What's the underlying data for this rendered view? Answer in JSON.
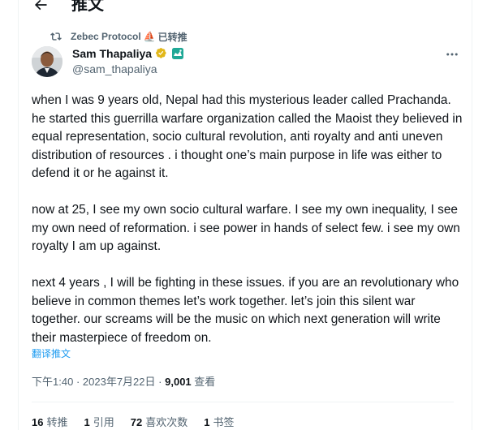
{
  "header": {
    "title": "推文",
    "back_icon": "arrow-left-icon"
  },
  "social_context": {
    "icon": "retweet-icon",
    "account": "Zebec Protocol",
    "emoji": "⛵",
    "action": "已转推"
  },
  "author": {
    "name": "Sam Thapaliya",
    "handle": "@sam_thapaliya",
    "verified_icon": "gold-verified-badge-icon",
    "affiliate_icon": "affiliate-badge-icon",
    "brand_gold": "#e2b719",
    "brand_teal": "#1fa896"
  },
  "tweet": {
    "text": "when I was 9 years old, Nepal had this mysterious leader called Prachanda. he started this guerrilla warfare organization called the Maoist they believed in equal representation, socio cultural revolution, anti royalty and anti uneven distribution of resources . i thought one’s main purpose in life was either to defend it or he against it.\n\nnow at 25, I see my own socio cultural warfare. I see my own inequality, I see my own need of reformation. i see power in hands of select few. i see my own royalty I am up against.\n\nnext 4 years , I will be fighting in these issues. if you are an revolutionary who believe in common themes let’s work together. let’s join this silent war together. our screams will be the music on which next generation will write their masterpiece of freedom on.",
    "translate_label": "翻译推文",
    "link_color": "#1d9bf0"
  },
  "meta": {
    "time": "下午1:40",
    "separator": "·",
    "date": "2023年7月22日",
    "views": "9,001",
    "views_label": "查看"
  },
  "stats": [
    {
      "count": "16",
      "label": "转推"
    },
    {
      "count": "1",
      "label": "引用"
    },
    {
      "count": "72",
      "label": "喜欢次数"
    },
    {
      "count": "1",
      "label": "书签"
    }
  ],
  "more_icon": "more-horizontal-icon"
}
